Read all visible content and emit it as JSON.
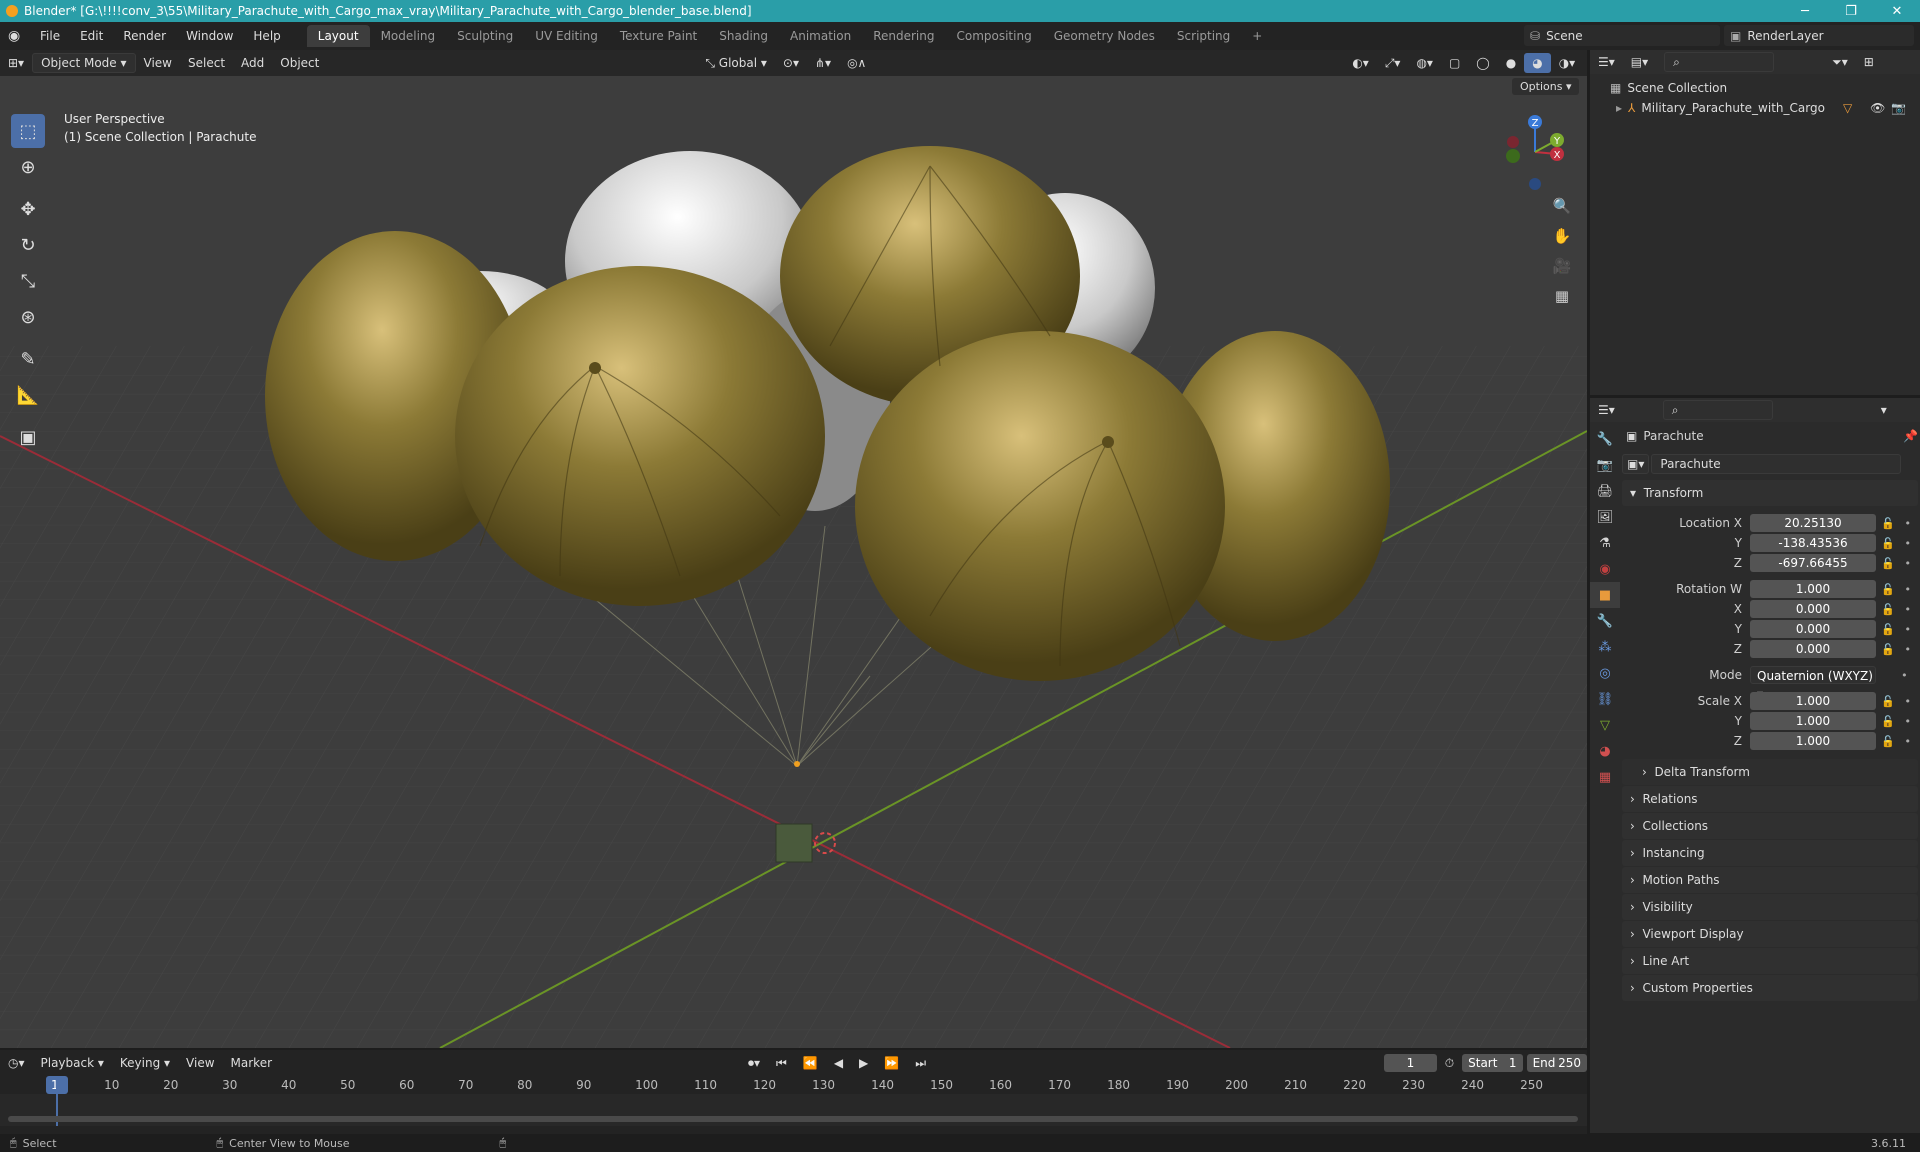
{
  "window": {
    "title": "Blender* [G:\\!!!!conv_3\\55\\Military_Parachute_with_Cargo_max_vray\\Military_Parachute_with_Cargo_blender_base.blend]",
    "minimize": "─",
    "maximize": "❐",
    "close": "✕"
  },
  "menu": [
    "File",
    "Edit",
    "Render",
    "Window",
    "Help"
  ],
  "workspaces": [
    "Layout",
    "Modeling",
    "Sculpting",
    "UV Editing",
    "Texture Paint",
    "Shading",
    "Animation",
    "Rendering",
    "Compositing",
    "Geometry Nodes",
    "Scripting"
  ],
  "add_workspace": "+",
  "scene": {
    "label": "Scene",
    "render_layer": "RenderLayer"
  },
  "viewport_header": {
    "mode": "Object Mode",
    "menus": [
      "View",
      "Select",
      "Add",
      "Object"
    ],
    "orientation": "Global",
    "options": "Options"
  },
  "viewport": {
    "perspective": "User Perspective",
    "collection_info": "(1) Scene Collection | Parachute",
    "gizmo": {
      "x": "X",
      "y": "Y",
      "z": "Z"
    }
  },
  "outliner": {
    "root": "Scene Collection",
    "item": "Military_Parachute_with_Cargo"
  },
  "properties": {
    "object_name": "Parachute",
    "data_name": "Parachute",
    "transform_title": "Transform",
    "location": {
      "label": "Location X",
      "x": "20.25130",
      "y": "-138.43536",
      "z": "-697.66455"
    },
    "rotation": {
      "label": "Rotation W",
      "w": "1.000",
      "x": "0.000",
      "y": "0.000",
      "z": "0.000"
    },
    "mode_label": "Mode",
    "mode_value": "Quaternion (WXYZ)",
    "scale": {
      "label": "Scale X",
      "x": "1.000",
      "y": "1.000",
      "z": "1.000"
    },
    "axis_labels": {
      "y": "Y",
      "z": "Z",
      "x": "X"
    },
    "delta": "Delta Transform",
    "panels": [
      "Relations",
      "Collections",
      "Instancing",
      "Motion Paths",
      "Visibility",
      "Viewport Display",
      "Line Art",
      "Custom Properties"
    ]
  },
  "timeline": {
    "menus": [
      "Playback",
      "Keying",
      "View",
      "Marker"
    ],
    "current_frame": "1",
    "start_label": "Start",
    "start": "1",
    "end_label": "End",
    "end": "250",
    "ruler": [
      "1",
      "10",
      "20",
      "30",
      "40",
      "50",
      "60",
      "70",
      "80",
      "90",
      "100",
      "110",
      "120",
      "130",
      "140",
      "150",
      "160",
      "170",
      "180",
      "190",
      "200",
      "210",
      "220",
      "230",
      "240",
      "250"
    ]
  },
  "status": {
    "select": "Select",
    "center": "Center View to Mouse",
    "version": "3.6.11"
  },
  "colors": {
    "accent": "#4c6fa8",
    "titlebar": "#2a9ea8",
    "x_axis": "#c0303f",
    "y_axis": "#7dab2f",
    "z_axis": "#3a7ad8"
  }
}
